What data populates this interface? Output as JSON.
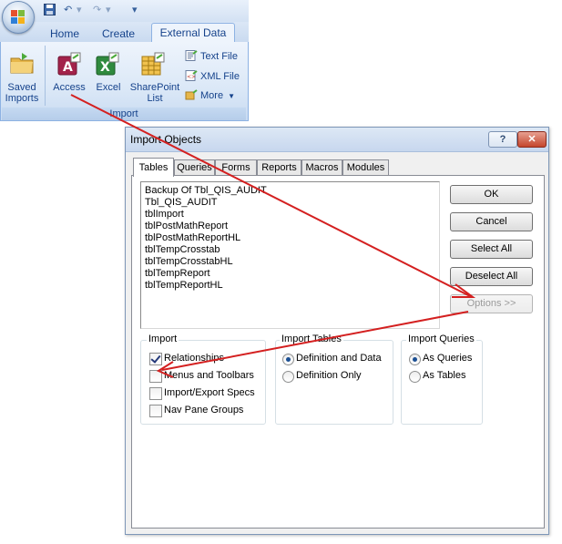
{
  "ribbon": {
    "tabs": [
      {
        "label": "Home"
      },
      {
        "label": "Create"
      },
      {
        "label": "External Data"
      }
    ],
    "buttons": {
      "saved_imports": {
        "line1": "Saved",
        "line2": "Imports"
      },
      "access": "Access",
      "excel": "Excel",
      "sharepoint": {
        "line1": "SharePoint",
        "line2": "List"
      },
      "text_file": "Text File",
      "xml_file": "XML File",
      "more": "More"
    },
    "group_label": "Import"
  },
  "dialog": {
    "title": "Import Objects",
    "help": "?",
    "close": "✕",
    "tabs": [
      "Tables",
      "Queries",
      "Forms",
      "Reports",
      "Macros",
      "Modules"
    ],
    "tables": [
      "Backup Of Tbl_QIS_AUDIT",
      "Tbl_QIS_AUDIT",
      "tblImport",
      "tblPostMathReport",
      "tblPostMathReportHL",
      "tblTempCrosstab",
      "tblTempCrosstabHL",
      "tblTempReport",
      "tblTempReportHL"
    ],
    "buttons": {
      "ok": "OK",
      "cancel": "Cancel",
      "select_all": "Select All",
      "deselect_all": "Deselect All",
      "options": "Options >>"
    },
    "import_group": {
      "label": "Import",
      "options": [
        {
          "label": "Relationships",
          "checked": true
        },
        {
          "label": "Menus and Toolbars",
          "checked": false
        },
        {
          "label": "Import/Export Specs",
          "checked": false
        },
        {
          "label": "Nav Pane Groups",
          "checked": false
        }
      ]
    },
    "import_tables_group": {
      "label": "Import Tables",
      "options": [
        {
          "label": "Definition and Data",
          "selected": true
        },
        {
          "label": "Definition Only",
          "selected": false
        }
      ]
    },
    "import_queries_group": {
      "label": "Import Queries",
      "options": [
        {
          "label": "As Queries",
          "selected": true
        },
        {
          "label": "As Tables",
          "selected": false
        }
      ]
    }
  },
  "colors": {
    "annotation_arrow": "#d42020",
    "ribbon_text": "#15428b"
  }
}
